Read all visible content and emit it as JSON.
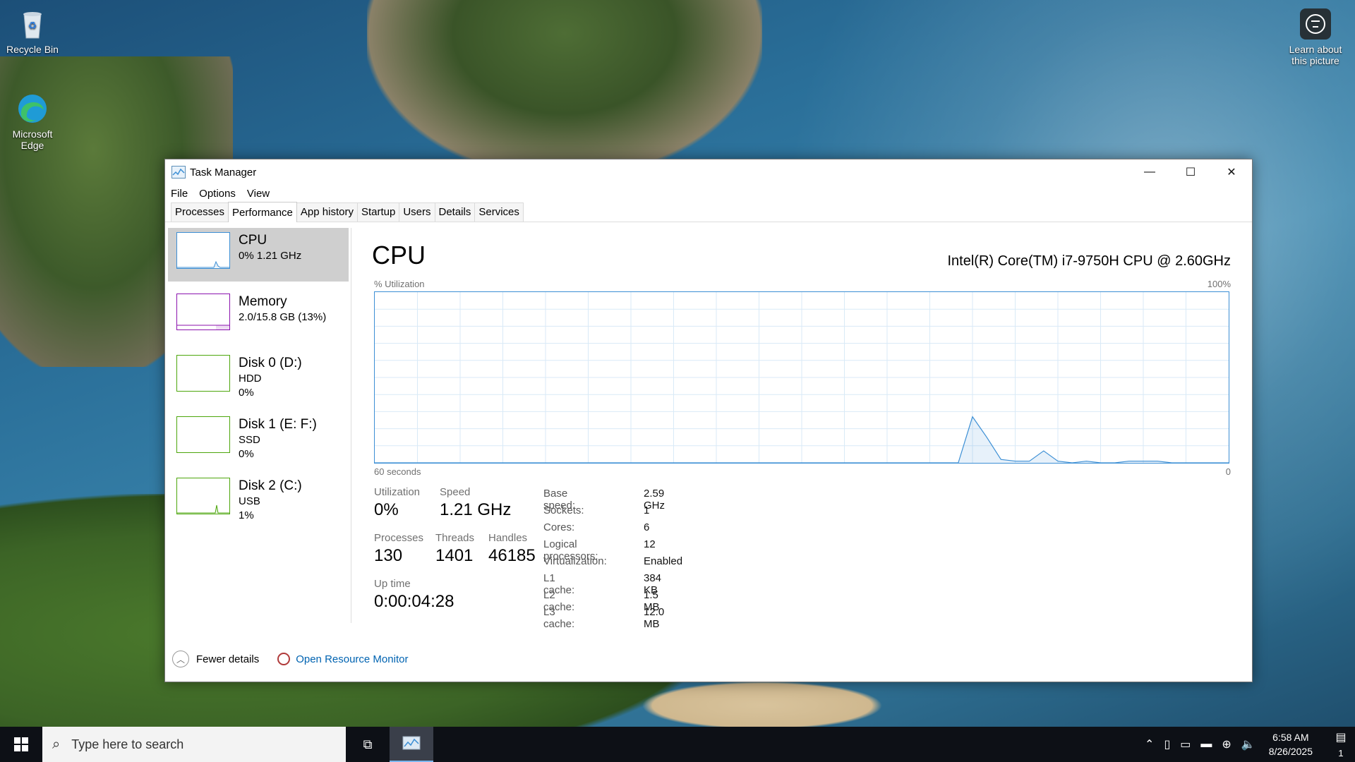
{
  "desktop": {
    "icons": [
      {
        "label": "Recycle Bin"
      },
      {
        "label": "Microsoft Edge"
      }
    ],
    "learn_about": "Learn about this picture"
  },
  "window": {
    "title": "Task Manager",
    "controls": {
      "minimize": "—",
      "maximize": "☐",
      "close": "✕"
    },
    "menu": [
      "File",
      "Options",
      "View"
    ],
    "tabs": [
      "Processes",
      "Performance",
      "App history",
      "Startup",
      "Users",
      "Details",
      "Services"
    ],
    "active_tab": "Performance"
  },
  "sidebar": {
    "items": [
      {
        "title": "CPU",
        "line1": "0%  1.21 GHz",
        "line2": "",
        "color": "#3c8fd5"
      },
      {
        "title": "Memory",
        "line1": "2.0/15.8 GB (13%)",
        "line2": "",
        "color": "#8b12ae"
      },
      {
        "title": "Disk 0 (D:)",
        "line1": "HDD",
        "line2": "0%",
        "color": "#4da60c"
      },
      {
        "title": "Disk 1 (E: F:)",
        "line1": "SSD",
        "line2": "0%",
        "color": "#4da60c"
      },
      {
        "title": "Disk 2 (C:)",
        "line1": "USB",
        "line2": "1%",
        "color": "#4da60c"
      }
    ]
  },
  "main": {
    "title": "CPU",
    "cpu_name": "Intel(R) Core(TM) i7-9750H CPU @ 2.60GHz",
    "util_label": "% Utilization",
    "util_max": "100%",
    "time_label": "60 seconds",
    "time_min": "0",
    "stats": {
      "utilization_label": "Utilization",
      "utilization": "0%",
      "speed_label": "Speed",
      "speed": "1.21 GHz",
      "processes_label": "Processes",
      "processes": "130",
      "threads_label": "Threads",
      "threads": "1401",
      "handles_label": "Handles",
      "handles": "46185",
      "uptime_label": "Up time",
      "uptime": "0:00:04:28"
    },
    "specs": [
      {
        "k": "Base speed:",
        "v": "2.59 GHz"
      },
      {
        "k": "Sockets:",
        "v": "1"
      },
      {
        "k": "Cores:",
        "v": "6"
      },
      {
        "k": "Logical processors:",
        "v": "12"
      },
      {
        "k": "Virtualization:",
        "v": "Enabled"
      },
      {
        "k": "L1 cache:",
        "v": "384 KB"
      },
      {
        "k": "L2 cache:",
        "v": "1.5 MB"
      },
      {
        "k": "L3 cache:",
        "v": "12.0 MB"
      }
    ]
  },
  "footer": {
    "fewer_details": "Fewer details",
    "open_resource_monitor": "Open Resource Monitor"
  },
  "taskbar": {
    "search_placeholder": "Type here to search",
    "time": "6:58 AM",
    "date": "8/26/2025",
    "notification_count": "1"
  },
  "chart_data": {
    "type": "line",
    "title": "",
    "xlabel": "60 seconds",
    "ylabel": "% Utilization",
    "x": [
      60,
      59,
      58,
      57,
      56,
      55,
      54,
      53,
      52,
      51,
      50,
      49,
      48,
      47,
      46,
      45,
      44,
      43,
      42,
      41,
      40,
      39,
      38,
      37,
      36,
      35,
      34,
      33,
      32,
      31,
      30,
      29,
      28,
      27,
      26,
      25,
      24,
      23,
      22,
      21,
      20,
      19,
      18,
      17,
      16,
      15,
      14,
      13,
      12,
      11,
      10,
      9,
      8,
      7,
      6,
      5,
      4,
      3,
      2,
      1,
      0
    ],
    "values": [
      0,
      0,
      0,
      0,
      0,
      0,
      0,
      0,
      0,
      0,
      0,
      0,
      0,
      0,
      0,
      0,
      0,
      0,
      0,
      0,
      0,
      0,
      0,
      0,
      0,
      0,
      0,
      0,
      0,
      0,
      0,
      0,
      0,
      0,
      0,
      0,
      0,
      0,
      0,
      0,
      0,
      0,
      27,
      15,
      2,
      1,
      1,
      7,
      1,
      0,
      1,
      0,
      0,
      1,
      1,
      1,
      0,
      0,
      0,
      0,
      0
    ],
    "ylim": [
      0,
      100
    ],
    "xlim": [
      60,
      0
    ],
    "grid": true,
    "color": "#3c8fd5"
  }
}
